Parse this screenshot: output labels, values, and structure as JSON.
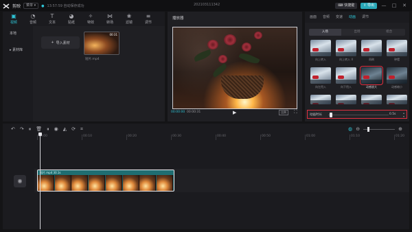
{
  "titlebar": {
    "app_name": "剪映",
    "menu_label": "菜单",
    "autosave_text": "13:57:59 自动保存成功",
    "project_title": "202103111342",
    "shortcut_label": "快捷键",
    "export_label": "导出",
    "window_controls": [
      "—",
      "□",
      "✕"
    ]
  },
  "media": {
    "tabs": [
      {
        "label": "视频",
        "icon": "video-icon",
        "glyph": "▣",
        "active": true
      },
      {
        "label": "音频",
        "icon": "audio-icon",
        "glyph": "◔",
        "active": false
      },
      {
        "label": "文本",
        "icon": "text-icon",
        "glyph": "T",
        "active": false
      },
      {
        "label": "贴纸",
        "icon": "sticker-icon",
        "glyph": "◕",
        "active": false
      },
      {
        "label": "特效",
        "icon": "effects-icon",
        "glyph": "✧",
        "active": false
      },
      {
        "label": "转场",
        "icon": "transition-icon",
        "glyph": "⋈",
        "active": false
      },
      {
        "label": "滤镜",
        "icon": "filter-icon",
        "glyph": "❀",
        "active": false
      },
      {
        "label": "调节",
        "icon": "adjust-icon",
        "glyph": "≡",
        "active": false
      }
    ],
    "side": [
      {
        "label": "本地",
        "active": true
      },
      {
        "label": "素材库",
        "active": false
      }
    ],
    "import_label": "导入素材",
    "clip_name": "短片.mp4",
    "clip_duration": "00:31"
  },
  "player": {
    "title": "播放器",
    "current_time": "00:00:00",
    "total_time": "00:00:31",
    "ratio_label": "比例"
  },
  "props": {
    "tabs": [
      {
        "label": "画面",
        "active": false
      },
      {
        "label": "音频",
        "active": false
      },
      {
        "label": "变速",
        "active": false
      },
      {
        "label": "动画",
        "active": true
      },
      {
        "label": "调节",
        "active": false
      }
    ],
    "sub_tabs": [
      {
        "label": "入场",
        "active": true
      },
      {
        "label": "出场",
        "active": false
      },
      {
        "label": "组合",
        "active": false
      }
    ],
    "animations": [
      {
        "label": "向上转入",
        "dark": false,
        "selected": false
      },
      {
        "label": "向上转入 II",
        "dark": false,
        "selected": false
      },
      {
        "label": "雨刷",
        "dark": false,
        "selected": false
      },
      {
        "label": "钟摆",
        "dark": false,
        "selected": false
      },
      {
        "label": "向左甩入",
        "dark": false,
        "selected": false
      },
      {
        "label": "向下甩入",
        "dark": false,
        "selected": false
      },
      {
        "label": "动感放大",
        "dark": true,
        "selected": true
      },
      {
        "label": "动感缩小",
        "dark": true,
        "selected": false
      },
      {
        "label": "",
        "dark": false,
        "selected": false
      },
      {
        "label": "",
        "dark": false,
        "selected": false
      },
      {
        "label": "",
        "dark": false,
        "selected": false
      },
      {
        "label": "",
        "dark": false,
        "selected": false
      }
    ],
    "duration_label": "动画时长",
    "duration_value": "0.5s",
    "duration_fraction": 0.05
  },
  "timeline": {
    "tools": [
      {
        "name": "undo-icon",
        "glyph": "↶"
      },
      {
        "name": "redo-icon",
        "glyph": "↷"
      },
      {
        "name": "split-icon",
        "glyph": "⏸"
      },
      {
        "name": "delete-icon",
        "glyph": "🗑"
      },
      {
        "name": "freeze-icon",
        "glyph": "⏸"
      },
      {
        "name": "record-icon",
        "glyph": "◉"
      },
      {
        "name": "mirror-icon",
        "glyph": "◭"
      },
      {
        "name": "rotate-icon",
        "glyph": "⟳"
      },
      {
        "name": "crop-icon",
        "glyph": "⌗"
      }
    ],
    "ruler_ticks": [
      "00:00",
      "00:10",
      "00:20",
      "00:30",
      "00:40",
      "00:50",
      "01:00",
      "01:10",
      "01:20"
    ],
    "clip_label": "短片.mp4  30.1s",
    "frame_count": 8
  }
}
